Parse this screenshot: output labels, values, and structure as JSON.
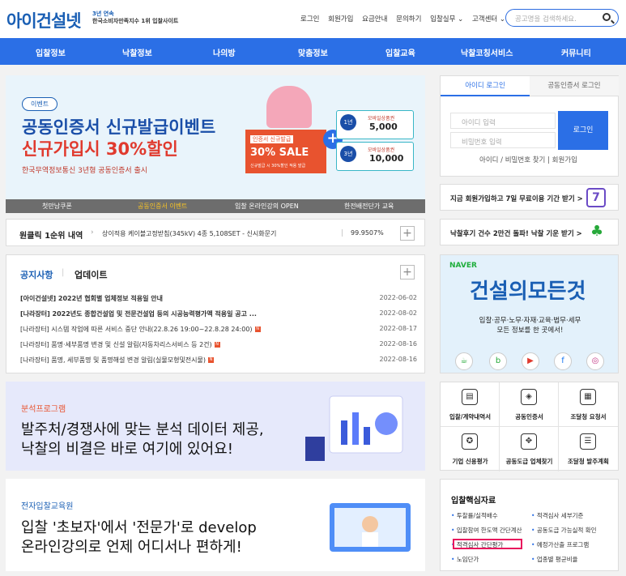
{
  "header": {
    "logo": "아이건설넷",
    "slogan_l1": "3년 연속",
    "slogan_l2": "한국소비자만족지수 1위 입찰사이트",
    "links": [
      "로그인",
      "회원가입",
      "요금안내",
      "문의하기",
      "입찰실무 ⌄",
      "고객센터 ⌄"
    ],
    "search_placeholder": "공고명을 검색하세요."
  },
  "nav": [
    "입찰정보",
    "낙찰정보",
    "나의방",
    "맞춤정보",
    "입찰교육",
    "낙찰코칭서비스",
    "커뮤니티"
  ],
  "banner": {
    "badge": "이벤트",
    "title1": "공동인증서 신규발급이벤트",
    "title2": "신규가입시 30%할인",
    "sub": "한국무역정보통신 3년형 공동인증서 출시",
    "coupon_a": "인증서 신규발급",
    "coupon_b": "30% SALE",
    "coupon_c": "신규발급 시 30%할인 적용 발급",
    "voucher1_tag": "1년",
    "voucher1_t": "모바일상품권",
    "voucher1_n": "5,000",
    "voucher2_tag": "3년",
    "voucher2_t": "모바일상품권",
    "voucher2_n": "10,000",
    "tabs": [
      "첫만남쿠폰",
      "공동인증서 이벤트",
      "입찰 온라인강의 OPEN",
      "한전배전단가 교육"
    ]
  },
  "click_winner": {
    "title": "원클릭 1순위 내역",
    "desc": "상이적용 케이블고정받침(345kV) 4종 5,108SET - 신시화문기",
    "pct": "99.9507%"
  },
  "notice": {
    "tab1": "공지사항",
    "tab2": "업데이트",
    "rows": [
      {
        "title": "[아이건설넷] 2022년 협회별 업체정보 적용일 안내",
        "date": "2022-06-02"
      },
      {
        "title": "[나라장터] 2022년도 종합건설업 및 전문건설업 등의 시공능력평가액 적용일 공고 ...",
        "date": "2022-08-02"
      },
      {
        "title": "[나라장터] 시스템 작업에 따른 서비스 중단 안내(22.8.26 19:00~22.8.28 24:00)",
        "date": "2022-08-17"
      },
      {
        "title": "[나라장터] 품명·세부품명 변경 및 신설 알림(자동차리스서비스 등 2건)",
        "date": "2022-08-16"
      },
      {
        "title": "[나라장터] 품명, 세부품명 및 품명해설 변경 알림(실물모형및전시물)",
        "date": "2022-08-16"
      }
    ]
  },
  "analysis": {
    "cap": "분석프로그램",
    "l1": "발주처/경쟁사에 맞는 분석 데이터 제공,",
    "l2": "낙찰의 비결은 바로 여기에 있어요!"
  },
  "edu": {
    "cap": "전자입찰교육원",
    "l1": "입찰 '초보자'에서 '전문가'로 develop",
    "l2": "온라인강의로 언제 어디서나 편하게!"
  },
  "login": {
    "tab1": "아이디 로그인",
    "tab2": "공동인증서 로그인",
    "id_ph": "아이디 입력",
    "pw_ph": "비밀번호 입력",
    "btn": "로그인",
    "links": "아이디 / 비밀번호 찾기  |  회원가입"
  },
  "promo1": {
    "text": "지금 회원가입하고 7일 무료이용 기간 받기 >",
    "badge": "7"
  },
  "promo2": {
    "text": "낙찰후기 건수 2만건 돌파! 낙찰 기운 받기 >"
  },
  "naver": {
    "brand": "NAVER",
    "big": "건설의모든것",
    "s1": "입찰·공무·노무·자재·교육·법무·세무",
    "s2": "모든 정보를 한 곳에서!"
  },
  "grid": [
    "입찰/계약내역서",
    "공동인증서",
    "조달청 요청서",
    "기업 신용평가",
    "공동도급 업체찾기",
    "조달청 발주계획"
  ],
  "core": {
    "title": "입찰핵심자료",
    "items": [
      "투찰률/실적배수",
      "적격심사 세부기준",
      "입찰참여 한도액 간단계산",
      "공동도급 가능실적 확인",
      "적격심사 간단평가",
      "예정가산출 프로그램",
      "노임단가",
      "업종별 평균비율"
    ]
  }
}
